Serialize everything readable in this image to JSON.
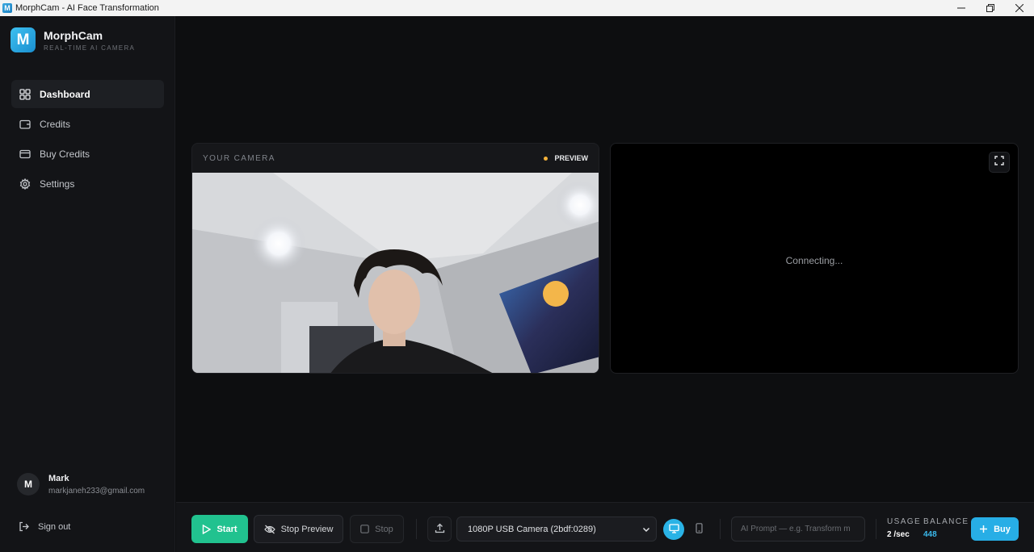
{
  "window": {
    "title": "MorphCam - AI Face Transformation",
    "controls": [
      "minimize",
      "restore",
      "close"
    ]
  },
  "brand": {
    "logo_letter": "M",
    "name": "MorphCam",
    "tagline": "REAL-TIME AI CAMERA"
  },
  "sidebar": {
    "items": [
      {
        "label": "Dashboard",
        "icon": "grid-icon",
        "active": true
      },
      {
        "label": "Credits",
        "icon": "wallet-icon",
        "active": false
      },
      {
        "label": "Buy Credits",
        "icon": "card-icon",
        "active": false
      },
      {
        "label": "Settings",
        "icon": "gear-icon",
        "active": false
      }
    ]
  },
  "user": {
    "initial": "M",
    "name": "Mark",
    "email": "markjaneh233@gmail.com"
  },
  "signout": {
    "label": "Sign out"
  },
  "camera_panel": {
    "label": "YOUR CAMERA",
    "status": "PREVIEW",
    "status_color": "#f4b23a"
  },
  "output_panel": {
    "status_text": "Connecting..."
  },
  "toolbar": {
    "start_label": "Start",
    "stop_preview_label": "Stop Preview",
    "stop_label": "Stop",
    "camera_device": "1080P USB Camera (2bdf:0289)",
    "prompt_placeholder": "AI Prompt — e.g. Transform m",
    "usage_label": "USAGE",
    "usage_value": "2 /sec",
    "balance_label": "BALANCE",
    "balance_value": "448",
    "buy_label": "Buy"
  },
  "colors": {
    "accent_green": "#21c28f",
    "accent_blue": "#27aee6",
    "background": "#0d0e10"
  }
}
